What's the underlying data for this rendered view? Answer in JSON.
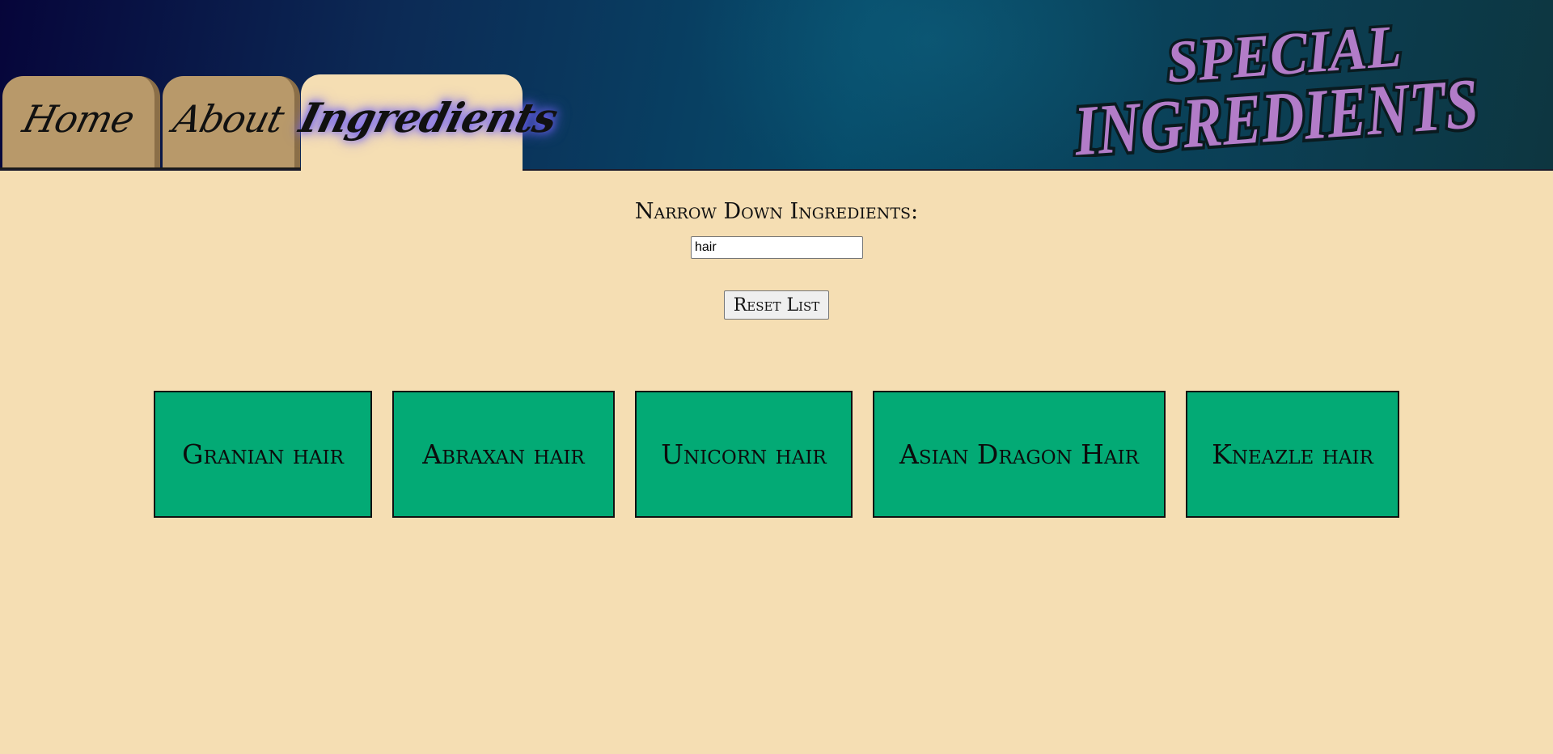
{
  "nav": {
    "tabs": [
      {
        "label": "Home",
        "active": false
      },
      {
        "label": "About",
        "active": false
      },
      {
        "label": "Ingredients",
        "active": true
      }
    ]
  },
  "logo": {
    "line1": "SPECIAL",
    "line2": "INGREDIENTS",
    "fill_color": "#b27cc8",
    "outline_color": "#0a1a1f"
  },
  "filter": {
    "title": "Narrow Down Ingredients:",
    "search_value": "hair",
    "reset_label": "Reset List"
  },
  "ingredients": [
    "Granian hair",
    "Abraxan hair",
    "Unicorn hair",
    "Asian Dragon Hair",
    "Kneazle hair"
  ],
  "colors": {
    "page_background": "#f5deb3",
    "card_background": "#03aa75",
    "tab_background": "#b8996a",
    "header_dark": "#06053a",
    "header_teal": "#064b69"
  }
}
